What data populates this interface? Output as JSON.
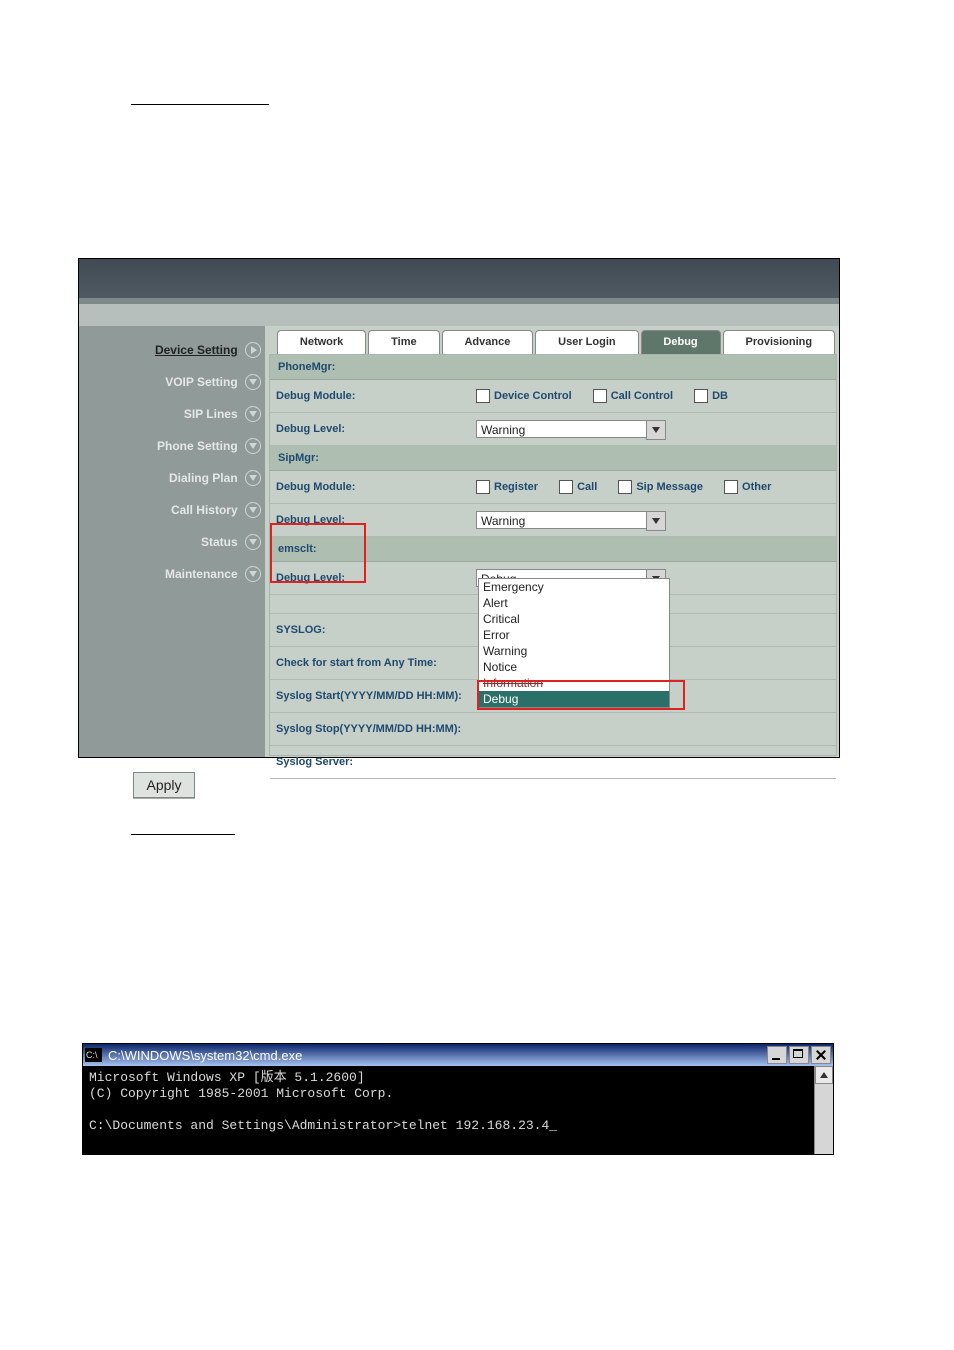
{
  "sidebar": {
    "items": [
      {
        "label": "Device Setting"
      },
      {
        "label": "VOIP Setting"
      },
      {
        "label": "SIP Lines"
      },
      {
        "label": "Phone Setting"
      },
      {
        "label": "Dialing Plan"
      },
      {
        "label": "Call History"
      },
      {
        "label": "Status"
      },
      {
        "label": "Maintenance"
      }
    ]
  },
  "tabs": {
    "items": [
      {
        "label": "Network"
      },
      {
        "label": "Time"
      },
      {
        "label": "Advance"
      },
      {
        "label": "User Login"
      },
      {
        "label": "Debug"
      },
      {
        "label": "Provisioning"
      }
    ]
  },
  "panel": {
    "phonemgr": {
      "title": "PhoneMgr:",
      "module_label": "Debug Module:",
      "module_cbs": [
        {
          "label": "Device Control"
        },
        {
          "label": "Call Control"
        },
        {
          "label": "DB"
        }
      ],
      "level_label": "Debug Level:",
      "level_value": "Warning"
    },
    "sipmgr": {
      "title": "SipMgr:",
      "module_label": "Debug Module:",
      "module_cbs": [
        {
          "label": "Register"
        },
        {
          "label": "Call"
        },
        {
          "label": "Sip Message"
        },
        {
          "label": "Other"
        }
      ],
      "level_label": "Debug Level:",
      "level_value": "Warning"
    },
    "emsclt": {
      "title": "emsclt:",
      "level_label": "Debug Level:",
      "level_value": "Debug"
    },
    "dropdown_options": [
      "Emergency",
      "Alert",
      "Critical",
      "Error",
      "Warning",
      "Notice",
      "Information",
      "Debug"
    ],
    "syslog": {
      "title": "SYSLOG:",
      "check_label": "Check for start from Any Time:",
      "start_label": "Syslog Start(YYYY/MM/DD HH:MM):",
      "stop_label": "Syslog Stop(YYYY/MM/DD HH:MM):",
      "server_label": "Syslog Server:"
    }
  },
  "apply_label": "Apply",
  "cmd": {
    "title": "C:\\WINDOWS\\system32\\cmd.exe",
    "icon": "C:\\",
    "line1": "Microsoft Windows XP [版本 5.1.2600]",
    "line2": "(C) Copyright 1985-2001 Microsoft Corp.",
    "line3": "C:\\Documents and Settings\\Administrator>telnet 192.168.23.4_"
  }
}
